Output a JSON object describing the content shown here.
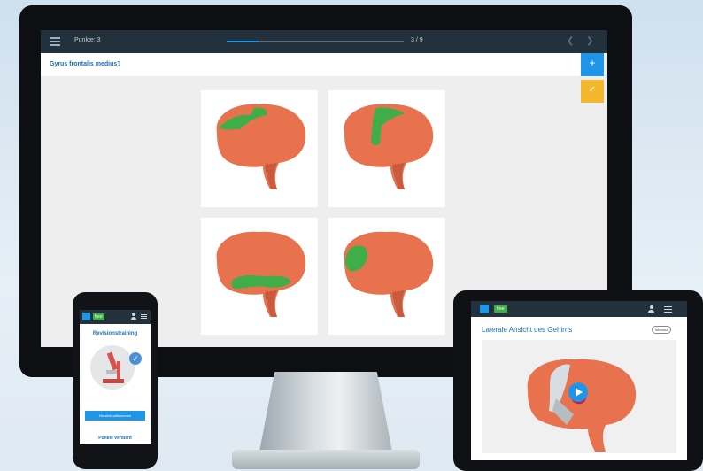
{
  "monitor": {
    "topbar": {
      "menu_icon": "hamburger-menu-icon",
      "score_label": "Punkte: 3",
      "progress_fraction": 0.18,
      "progress_text": "3 / 9",
      "nav_icons": [
        "chevron-left-icon",
        "chevron-right-icon"
      ]
    },
    "question": "Gyrus frontalis medius?",
    "side_buttons": [
      {
        "icon": "plus-icon",
        "color": "#1e95e6"
      },
      {
        "icon": "check-icon",
        "color": "#f2b72c"
      }
    ],
    "answer_options": [
      {
        "icon": "brain-highlight-superior-frontal"
      },
      {
        "icon": "brain-highlight-middle-frontal"
      },
      {
        "icon": "brain-highlight-temporal"
      },
      {
        "icon": "brain-highlight-frontal-pole"
      }
    ],
    "colors": {
      "brain": "#e8724e",
      "highlight": "#3fae49",
      "topbar": "#23313d",
      "accent": "#1e95e6"
    }
  },
  "phone": {
    "badge": "free",
    "section_title": "Revisionstraining",
    "button_label": "Herzlich willkommen",
    "footer_text": "Punkte verdient",
    "illustration": "microscope-icon"
  },
  "tablet": {
    "badge": "free",
    "title": "Laterale Ansicht des Gehirns",
    "tag": "Inbound",
    "media_icon": "play-icon",
    "illustration": "brain-lateral-view"
  }
}
